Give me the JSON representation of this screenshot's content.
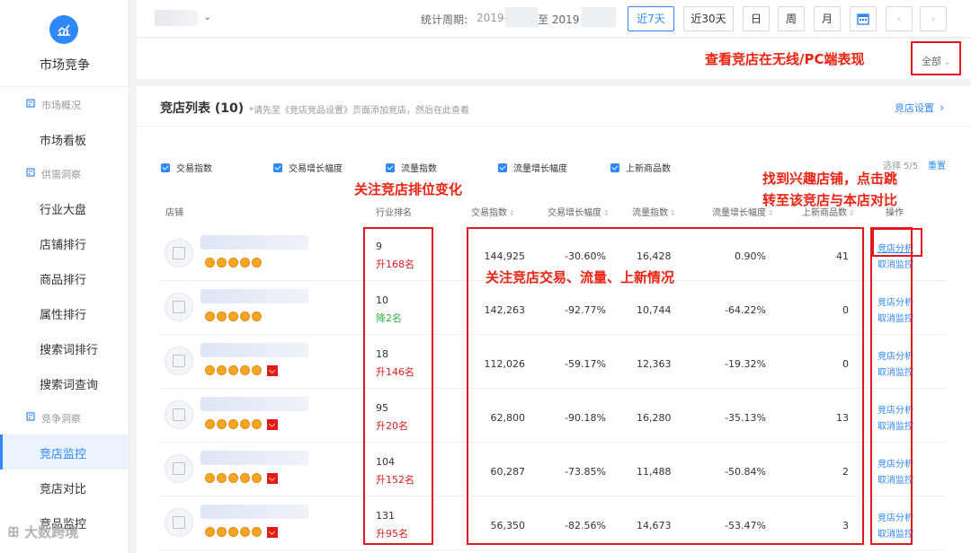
{
  "sidebar": {
    "title": "市场竞争",
    "sections": [
      {
        "label": "市场概况",
        "items": [
          "市场看板"
        ]
      },
      {
        "label": "供需洞察",
        "items": [
          "行业大盘",
          "店铺排行",
          "商品排行",
          "属性排行",
          "搜索词排行",
          "搜索词查询"
        ]
      },
      {
        "label": "竞争洞察",
        "items": [
          "竞店监控",
          "竞店对比",
          "竞品监控"
        ]
      }
    ],
    "active_item": "竞店监控"
  },
  "topbar": {
    "period_label": "统计周期:",
    "date_from": "2019-",
    "date_sep": "至 2019",
    "buttons": [
      "近7天",
      "近30天",
      "日",
      "周",
      "月"
    ],
    "selected": "近7天"
  },
  "subbar": {
    "device_filter": "全部",
    "annotation": "查看竞店在无线/PC端表现"
  },
  "panel": {
    "title": "竞店列表 (10)",
    "hint": "*请先至《竞店竞品设置》页面添加竞店，然后在此查看",
    "settings_link": "竞店设置",
    "checkboxes": [
      "交易指数",
      "交易增长幅度",
      "流量指数",
      "流量增长幅度",
      "上新商品数"
    ],
    "selected_count": "选择 5/5",
    "reset_label": "重置",
    "columns": [
      "店铺",
      "行业排名",
      "交易指数",
      "交易增长幅度",
      "流量指数",
      "流量增长幅度",
      "上新商品数",
      "操作"
    ],
    "rows": [
      {
        "rank": "9",
        "change": "升168名",
        "dir": "up",
        "trade": "144,925",
        "trade_growth": "-30.60%",
        "traffic": "16,428",
        "traffic_growth": "0.90%",
        "new_items": "41",
        "badge": false
      },
      {
        "rank": "10",
        "change": "降2名",
        "dir": "down",
        "trade": "142,263",
        "trade_growth": "-92.77%",
        "traffic": "10,744",
        "traffic_growth": "-64.22%",
        "new_items": "0",
        "badge": false
      },
      {
        "rank": "18",
        "change": "升146名",
        "dir": "up",
        "trade": "112,026",
        "trade_growth": "-59.17%",
        "traffic": "12,363",
        "traffic_growth": "-19.32%",
        "new_items": "0",
        "badge": true
      },
      {
        "rank": "95",
        "change": "升20名",
        "dir": "up",
        "trade": "62,800",
        "trade_growth": "-90.18%",
        "traffic": "16,280",
        "traffic_growth": "-35.13%",
        "new_items": "13",
        "badge": true
      },
      {
        "rank": "104",
        "change": "升152名",
        "dir": "up",
        "trade": "60,287",
        "trade_growth": "-73.85%",
        "traffic": "11,488",
        "traffic_growth": "-50.84%",
        "new_items": "2",
        "badge": true
      },
      {
        "rank": "131",
        "change": "升95名",
        "dir": "up",
        "trade": "56,350",
        "trade_growth": "-82.56%",
        "traffic": "14,673",
        "traffic_growth": "-53.47%",
        "new_items": "3",
        "badge": true
      }
    ],
    "op_analyze": "竞店分析",
    "op_cancel": "取消监控"
  },
  "annotations": {
    "rank_note": "关注竞店排位变化",
    "data_note": "关注竞店交易、流量、上新情况",
    "op_note_line1": "找到兴趣店铺，点击跳",
    "op_note_line2": "转至该竞店与本店对比"
  },
  "watermark": "大数跨境",
  "colors": {
    "accent": "#2f88ff",
    "annotation": "#e4191f",
    "up": "#e4191f",
    "down": "#2bb64b"
  }
}
